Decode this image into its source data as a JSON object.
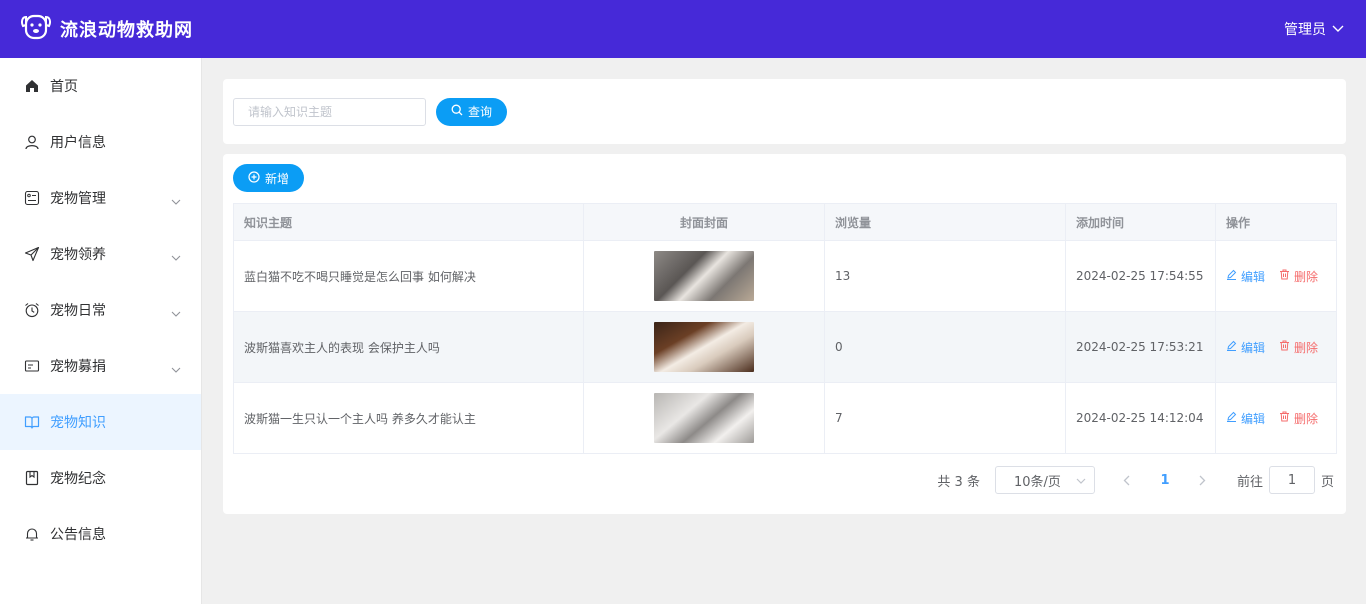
{
  "header": {
    "title": "流浪动物救助网",
    "user_label": "管理员",
    "bg_color": "#4629d8"
  },
  "sidebar": {
    "items": [
      {
        "label": "首页",
        "icon": "home-icon",
        "caret": false,
        "active": false
      },
      {
        "label": "用户信息",
        "icon": "user-icon",
        "caret": false,
        "active": false
      },
      {
        "label": "宠物管理",
        "icon": "list-icon",
        "caret": true,
        "active": false
      },
      {
        "label": "宠物领养",
        "icon": "send-icon",
        "caret": true,
        "active": false
      },
      {
        "label": "宠物日常",
        "icon": "alarm-clock-icon",
        "caret": true,
        "active": false
      },
      {
        "label": "宠物募捐",
        "icon": "card-icon",
        "caret": true,
        "active": false
      },
      {
        "label": "宠物知识",
        "icon": "book-icon",
        "caret": false,
        "active": true
      },
      {
        "label": "宠物纪念",
        "icon": "notebook-icon",
        "caret": false,
        "active": false
      },
      {
        "label": "公告信息",
        "icon": "bell-icon",
        "caret": false,
        "active": false
      }
    ]
  },
  "search": {
    "placeholder": "请输入知识主题",
    "value": "",
    "button_label": "查询"
  },
  "toolbar": {
    "add_label": "新增"
  },
  "table": {
    "columns": [
      "知识主题",
      "封面封面",
      "浏览量",
      "添加时间",
      "操作"
    ],
    "rows": [
      {
        "title": "蓝白猫不吃不喝只睡觉是怎么回事 如何解决",
        "views": "13",
        "time": "2024-02-25 17:54:55"
      },
      {
        "title": "波斯猫喜欢主人的表现 会保护主人吗",
        "views": "0",
        "time": "2024-02-25 17:53:21"
      },
      {
        "title": "波斯猫一生只认一个主人吗 养多久才能认主",
        "views": "7",
        "time": "2024-02-25 14:12:04"
      }
    ],
    "edit_label": "编辑",
    "delete_label": "删除"
  },
  "pagination": {
    "total_text": "共 3 条",
    "page_size": "10条/页",
    "current_page": "1",
    "goto_prefix": "前往",
    "goto_value": "1",
    "goto_suffix": "页"
  },
  "colors": {
    "accent": "#409eff",
    "button": "#0b9df5",
    "danger": "#f56c6c"
  }
}
